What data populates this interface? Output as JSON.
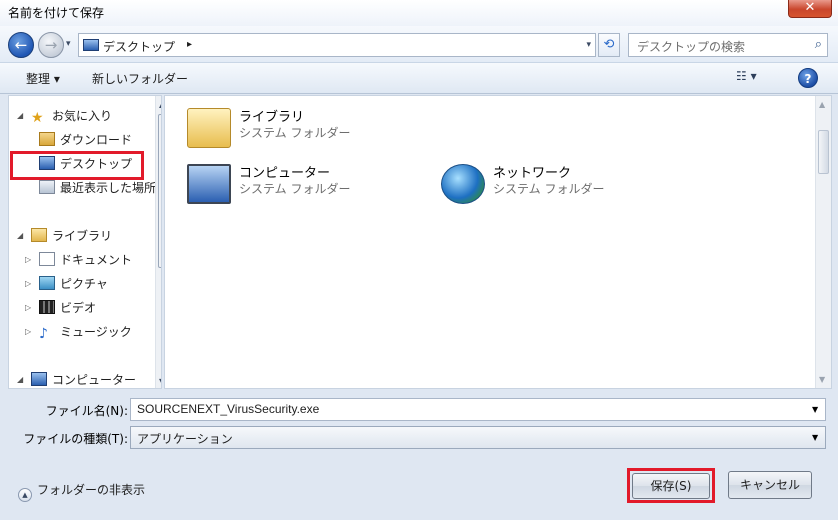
{
  "window": {
    "title": "名前を付けて保存",
    "close_label": "✕"
  },
  "navbar": {
    "back_icon": "←",
    "forward_icon": "→",
    "address_path": "デスクトップ",
    "address_sep": "▸",
    "refresh_icon": "⟲",
    "search_placeholder": "デスクトップの検索",
    "search_icon": "⌕"
  },
  "toolbar": {
    "organize_label": "整理 ▾",
    "new_folder_label": "新しいフォルダー",
    "view_icon": "☷ ▾",
    "help_icon": "?"
  },
  "nav_pane": {
    "favorites": {
      "label": "お気に入り"
    },
    "downloads": {
      "label": "ダウンロード"
    },
    "desktop": {
      "label": "デスクトップ",
      "selected": true
    },
    "recent": {
      "label": "最近表示した場所"
    },
    "libraries": {
      "label": "ライブラリ"
    },
    "documents": {
      "label": "ドキュメント"
    },
    "pictures": {
      "label": "ピクチャ"
    },
    "videos": {
      "label": "ビデオ"
    },
    "music": {
      "label": "ミュージック"
    },
    "computer": {
      "label": "コンピューター"
    }
  },
  "content": {
    "items": [
      {
        "name": "ライブラリ",
        "type": "システム フォルダー",
        "icon": "library-folder-icon"
      },
      {
        "name": "コンピューター",
        "type": "システム フォルダー",
        "icon": "computer-icon"
      },
      {
        "name": "ネットワーク",
        "type": "システム フォルダー",
        "icon": "network-globe-icon"
      }
    ]
  },
  "form": {
    "filename_label": "ファイル名(N):",
    "filename_value": "SOURCENEXT_VirusSecurity.exe",
    "filetype_label": "ファイルの種類(T):",
    "filetype_value": "アプリケーション"
  },
  "footer": {
    "hide_folders_label": "フォルダーの非表示",
    "save_label": "保存(S)",
    "cancel_label": "キャンセル"
  },
  "colors": {
    "highlight_outline": "#e21a2a"
  }
}
